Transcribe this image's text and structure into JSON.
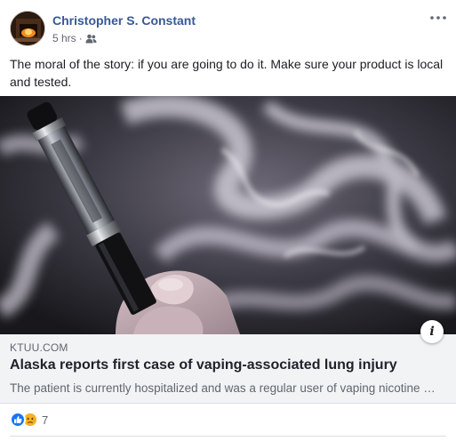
{
  "post": {
    "author": "Christopher S. Constant",
    "timestamp": "5 hrs",
    "separator": "·",
    "audience_icon": "friends-icon",
    "more_icon": "more-options-icon",
    "message": "The moral of the story: if you are going to do it. Make sure your product is local and tested."
  },
  "link": {
    "domain": "KTUU.COM",
    "headline": "Alaska reports first case of vaping-associated lung injury",
    "description": "The patient is currently hospitalized and was a regular user of vaping nicotine products.",
    "info_label": "i"
  },
  "reactions": {
    "types": [
      "like-icon",
      "sad-icon"
    ],
    "count": "7"
  },
  "colors": {
    "author": "#385898",
    "link_bg": "#f2f3f5",
    "like": "#1877f2",
    "sad": "#f7b125"
  }
}
